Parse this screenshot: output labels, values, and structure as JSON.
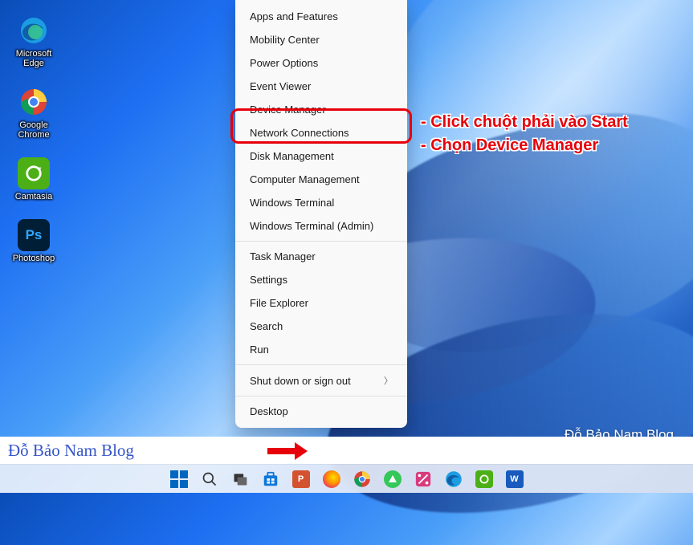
{
  "desktop_icons": [
    {
      "id": "edge",
      "label": "Microsoft Edge"
    },
    {
      "id": "chrome",
      "label": "Google Chrome"
    },
    {
      "id": "camtasia",
      "label": "Camtasia"
    },
    {
      "id": "photoshop",
      "label": "Photoshop"
    }
  ],
  "context_menu": {
    "group1": [
      "Apps and Features",
      "Mobility Center",
      "Power Options",
      "Event Viewer",
      "Device Manager",
      "Network Connections",
      "Disk Management",
      "Computer Management",
      "Windows Terminal",
      "Windows Terminal (Admin)"
    ],
    "group2": [
      "Task Manager",
      "Settings",
      "File Explorer",
      "Search",
      "Run"
    ],
    "group3": [
      {
        "label": "Shut down or sign out",
        "submenu": true
      }
    ],
    "group4": [
      "Desktop"
    ]
  },
  "highlighted_item": "Device Manager",
  "annotation": {
    "line1": "- Click chuột phải vào Start",
    "line2": "- Chọn Device Manager"
  },
  "watermark": "Đỗ Bảo Nam Blog",
  "blogbar": "Đỗ Bảo Nam Blog",
  "taskbar": [
    {
      "id": "start",
      "name": "start-button"
    },
    {
      "id": "search",
      "name": "search-icon"
    },
    {
      "id": "taskview",
      "name": "task-view-icon"
    },
    {
      "id": "store",
      "name": "microsoft-store-icon"
    },
    {
      "id": "powerpoint",
      "name": "powerpoint-icon"
    },
    {
      "id": "firefox",
      "name": "firefox-icon"
    },
    {
      "id": "chrome",
      "name": "chrome-icon"
    },
    {
      "id": "airdroid",
      "name": "airdroid-icon"
    },
    {
      "id": "snip",
      "name": "snip-sketch-icon"
    },
    {
      "id": "edge",
      "name": "edge-icon"
    },
    {
      "id": "camtasia",
      "name": "camtasia-icon"
    },
    {
      "id": "word",
      "name": "word-icon"
    }
  ]
}
